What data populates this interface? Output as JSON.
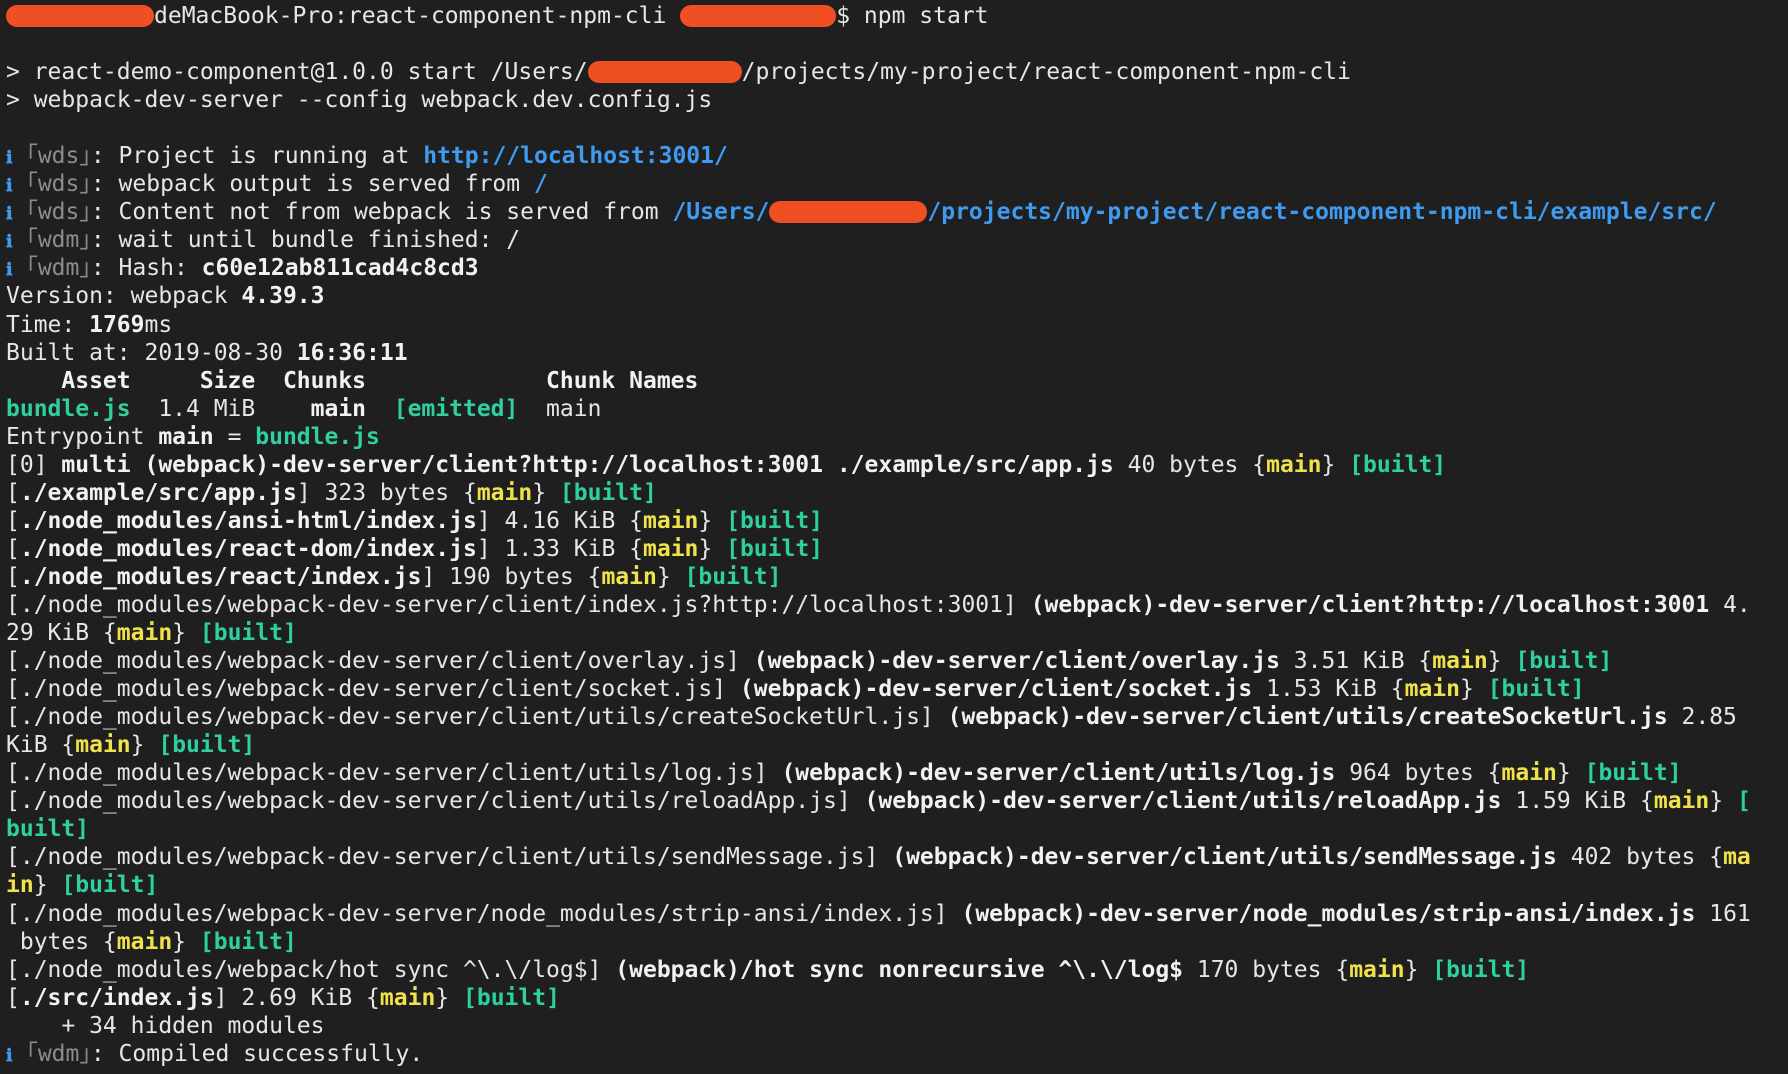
{
  "colors": {
    "background": "#1f1f1f",
    "text": "#e6e6e6",
    "green": "#2fd0a0",
    "yellow": "#f0e24a",
    "blue": "#3f9bf0",
    "dim": "#8c8c8c",
    "redaction": "#f04e23"
  },
  "terminal": {
    "lines": [
      [
        {
          "t": "redact",
          "w": 148
        },
        {
          "t": "deMacBook-Pro:react-component-npm-cli "
        },
        {
          "t": "redact",
          "w": 156
        },
        {
          "t": "$ npm start"
        }
      ],
      [],
      [
        {
          "t": "> react-demo-component@1.0.0 start /Users/"
        },
        {
          "t": "redact",
          "w": 154
        },
        {
          "t": "/projects/my-project/react-component-npm-cli"
        }
      ],
      [
        {
          "t": "> webpack-dev-server --config webpack.dev.config.js"
        }
      ],
      [],
      [
        {
          "t": "ℹ",
          "c": "i"
        },
        {
          "t": " ｢wds｣",
          "c": "d"
        },
        {
          "t": ": Project is running at "
        },
        {
          "t": "http://localhost:3001/",
          "c": "ub"
        }
      ],
      [
        {
          "t": "ℹ",
          "c": "i"
        },
        {
          "t": " ｢wds｣",
          "c": "d"
        },
        {
          "t": ": webpack output is served from "
        },
        {
          "t": "/",
          "c": "ub"
        }
      ],
      [
        {
          "t": "ℹ",
          "c": "i"
        },
        {
          "t": " ｢wds｣",
          "c": "d"
        },
        {
          "t": ": Content not from webpack is served from "
        },
        {
          "t": "/Users/",
          "c": "ub"
        },
        {
          "t": "redact",
          "w": 158
        },
        {
          "t": "/projects/my-project/react-component-npm-cli/example/src/",
          "c": "ub"
        }
      ],
      [
        {
          "t": "ℹ",
          "c": "i"
        },
        {
          "t": " ｢wdm｣",
          "c": "d"
        },
        {
          "t": ": wait until bundle finished: /"
        }
      ],
      [
        {
          "t": "ℹ",
          "c": "i"
        },
        {
          "t": " ｢wdm｣",
          "c": "d"
        },
        {
          "t": ": Hash: "
        },
        {
          "t": "c60e12ab811cad4c8cd3",
          "c": "b"
        }
      ],
      [
        {
          "t": "Version: webpack "
        },
        {
          "t": "4.39.3",
          "c": "b"
        }
      ],
      [
        {
          "t": "Time: "
        },
        {
          "t": "1769",
          "c": "b"
        },
        {
          "t": "ms"
        }
      ],
      [
        {
          "t": "Built at: 2019-08-30 "
        },
        {
          "t": "16:36:11",
          "c": "b"
        }
      ],
      [
        {
          "t": "    Asset     Size  Chunks             Chunk Names",
          "c": "b"
        }
      ],
      [
        {
          "t": "bundle.js",
          "c": "g"
        },
        {
          "t": "  1.4 MiB    "
        },
        {
          "t": "main",
          "c": "b"
        },
        {
          "t": "  "
        },
        {
          "t": "[emitted]",
          "c": "g"
        },
        {
          "t": "  main"
        }
      ],
      [
        {
          "t": "Entrypoint "
        },
        {
          "t": "main",
          "c": "b"
        },
        {
          "t": " = "
        },
        {
          "t": "bundle.js",
          "c": "g"
        }
      ],
      [
        {
          "t": "[0] "
        },
        {
          "t": "multi (webpack)-dev-server/client?http://localhost:3001 ./example/src/app.js",
          "c": "b"
        },
        {
          "t": " 40 bytes {"
        },
        {
          "t": "main",
          "c": "y"
        },
        {
          "t": "} "
        },
        {
          "t": "[built]",
          "c": "g"
        }
      ],
      [
        {
          "t": "["
        },
        {
          "t": "./example/src/app.js",
          "c": "b"
        },
        {
          "t": "] 323 bytes {"
        },
        {
          "t": "main",
          "c": "y"
        },
        {
          "t": "} "
        },
        {
          "t": "[built]",
          "c": "g"
        }
      ],
      [
        {
          "t": "["
        },
        {
          "t": "./node_modules/ansi-html/index.js",
          "c": "b"
        },
        {
          "t": "] 4.16 KiB {"
        },
        {
          "t": "main",
          "c": "y"
        },
        {
          "t": "} "
        },
        {
          "t": "[built]",
          "c": "g"
        }
      ],
      [
        {
          "t": "["
        },
        {
          "t": "./node_modules/react-dom/index.js",
          "c": "b"
        },
        {
          "t": "] 1.33 KiB {"
        },
        {
          "t": "main",
          "c": "y"
        },
        {
          "t": "} "
        },
        {
          "t": "[built]",
          "c": "g"
        }
      ],
      [
        {
          "t": "["
        },
        {
          "t": "./node_modules/react/index.js",
          "c": "b"
        },
        {
          "t": "] 190 bytes {"
        },
        {
          "t": "main",
          "c": "y"
        },
        {
          "t": "} "
        },
        {
          "t": "[built]",
          "c": "g"
        }
      ],
      [
        {
          "t": "[./node_modules/webpack-dev-server/client/index.js?http://localhost:3001] "
        },
        {
          "t": "(webpack)-dev-server/client?http://localhost:3001",
          "c": "b"
        },
        {
          "t": " 4."
        }
      ],
      [
        {
          "t": "29 KiB {"
        },
        {
          "t": "main",
          "c": "y"
        },
        {
          "t": "} "
        },
        {
          "t": "[built]",
          "c": "g"
        }
      ],
      [
        {
          "t": "[./node_modules/webpack-dev-server/client/overlay.js] "
        },
        {
          "t": "(webpack)-dev-server/client/overlay.js",
          "c": "b"
        },
        {
          "t": " 3.51 KiB {"
        },
        {
          "t": "main",
          "c": "y"
        },
        {
          "t": "} "
        },
        {
          "t": "[built]",
          "c": "g"
        }
      ],
      [
        {
          "t": "[./node_modules/webpack-dev-server/client/socket.js] "
        },
        {
          "t": "(webpack)-dev-server/client/socket.js",
          "c": "b"
        },
        {
          "t": " 1.53 KiB {"
        },
        {
          "t": "main",
          "c": "y"
        },
        {
          "t": "} "
        },
        {
          "t": "[built]",
          "c": "g"
        }
      ],
      [
        {
          "t": "[./node_modules/webpack-dev-server/client/utils/createSocketUrl.js] "
        },
        {
          "t": "(webpack)-dev-server/client/utils/createSocketUrl.js",
          "c": "b"
        },
        {
          "t": " 2.85"
        }
      ],
      [
        {
          "t": "KiB {"
        },
        {
          "t": "main",
          "c": "y"
        },
        {
          "t": "} "
        },
        {
          "t": "[built]",
          "c": "g"
        }
      ],
      [
        {
          "t": "[./node_modules/webpack-dev-server/client/utils/log.js] "
        },
        {
          "t": "(webpack)-dev-server/client/utils/log.js",
          "c": "b"
        },
        {
          "t": " 964 bytes {"
        },
        {
          "t": "main",
          "c": "y"
        },
        {
          "t": "} "
        },
        {
          "t": "[built]",
          "c": "g"
        }
      ],
      [
        {
          "t": "[./node_modules/webpack-dev-server/client/utils/reloadApp.js] "
        },
        {
          "t": "(webpack)-dev-server/client/utils/reloadApp.js",
          "c": "b"
        },
        {
          "t": " 1.59 KiB {"
        },
        {
          "t": "main",
          "c": "y"
        },
        {
          "t": "} "
        },
        {
          "t": "[",
          "c": "g"
        }
      ],
      [
        {
          "t": "built]",
          "c": "g"
        }
      ],
      [
        {
          "t": "[./node_modules/webpack-dev-server/client/utils/sendMessage.js] "
        },
        {
          "t": "(webpack)-dev-server/client/utils/sendMessage.js",
          "c": "b"
        },
        {
          "t": " 402 bytes {"
        },
        {
          "t": "ma",
          "c": "y"
        }
      ],
      [
        {
          "t": "in",
          "c": "y"
        },
        {
          "t": "} "
        },
        {
          "t": "[built]",
          "c": "g"
        }
      ],
      [
        {
          "t": "[./node_modules/webpack-dev-server/node_modules/strip-ansi/index.js] "
        },
        {
          "t": "(webpack)-dev-server/node_modules/strip-ansi/index.js",
          "c": "b"
        },
        {
          "t": " 161"
        }
      ],
      [
        {
          "t": " bytes {"
        },
        {
          "t": "main",
          "c": "y"
        },
        {
          "t": "} "
        },
        {
          "t": "[built]",
          "c": "g"
        }
      ],
      [
        {
          "t": "[./node_modules/webpack/hot sync ^\\.\\/log$] "
        },
        {
          "t": "(webpack)/hot sync nonrecursive ^\\.\\/log$",
          "c": "b"
        },
        {
          "t": " 170 bytes {"
        },
        {
          "t": "main",
          "c": "y"
        },
        {
          "t": "} "
        },
        {
          "t": "[built]",
          "c": "g"
        }
      ],
      [
        {
          "t": "["
        },
        {
          "t": "./src/index.js",
          "c": "b"
        },
        {
          "t": "] 2.69 KiB {"
        },
        {
          "t": "main",
          "c": "y"
        },
        {
          "t": "} "
        },
        {
          "t": "[built]",
          "c": "g"
        }
      ],
      [
        {
          "t": "    + 34 hidden modules"
        }
      ],
      [
        {
          "t": "ℹ",
          "c": "i"
        },
        {
          "t": " ｢wdm｣",
          "c": "d"
        },
        {
          "t": ": Compiled successfully."
        }
      ]
    ]
  }
}
